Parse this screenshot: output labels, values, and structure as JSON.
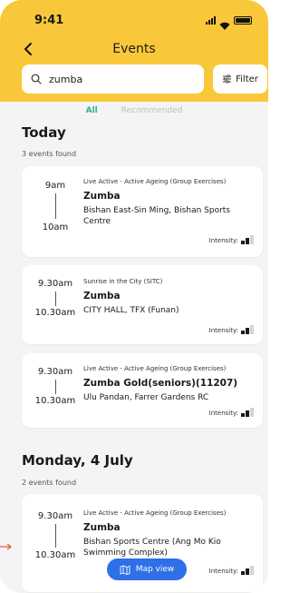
{
  "status": {
    "time": "9:41"
  },
  "header": {
    "title": "Events"
  },
  "search": {
    "value": "zumba",
    "icon": "search-icon"
  },
  "filter": {
    "label": "Filter",
    "icon": "sliders-icon"
  },
  "tabs": [
    {
      "label": "All",
      "active": true
    },
    {
      "label": "Recommended",
      "active": false
    }
  ],
  "sections": [
    {
      "title": "Today",
      "count_label": "3 events found"
    },
    {
      "title": "Monday, 4 July",
      "count_label": "2 events found"
    }
  ],
  "events": [
    {
      "start": "9am",
      "end": "10am",
      "org": "Live Active - Active Ageing (Group Exercises)",
      "activity": "Zumba",
      "location": "Bishan East-Sin Ming, Bishan Sports Centre",
      "intensity_label": "Intensity:",
      "intensity_level": 2
    },
    {
      "start": "9.30am",
      "end": "10.30am",
      "org": "Sunrise in the City (SITC)",
      "activity": "Zumba",
      "location": "CITY HALL, TFX (Funan)",
      "intensity_label": "Intensity:",
      "intensity_level": 2
    },
    {
      "start": "9.30am",
      "end": "10.30am",
      "org": "Live Active - Active Ageing (Group Exercises)",
      "activity": "Zumba Gold(seniors)(11207)",
      "location": "Ulu Pandan, Farrer Gardens RC",
      "intensity_label": "Intensity:",
      "intensity_level": 2
    },
    {
      "start": "9.30am",
      "end": "10.30am",
      "org": "Live Active - Active Ageing (Group Exercises)",
      "activity": "Zumba",
      "location": "Bishan Sports Centre (Ang Mo Kio Swimming Complex)",
      "intensity_label": "Intensity:",
      "intensity_level": 2
    }
  ],
  "map_button": {
    "label": "Map view",
    "icon": "map-icon"
  },
  "colors": {
    "header": "#f9c83a",
    "accent": "#2db08a",
    "map_button": "#2f6fe8",
    "intensity_filled": "#1a1a1a",
    "intensity_empty": "#d4d4d4"
  }
}
